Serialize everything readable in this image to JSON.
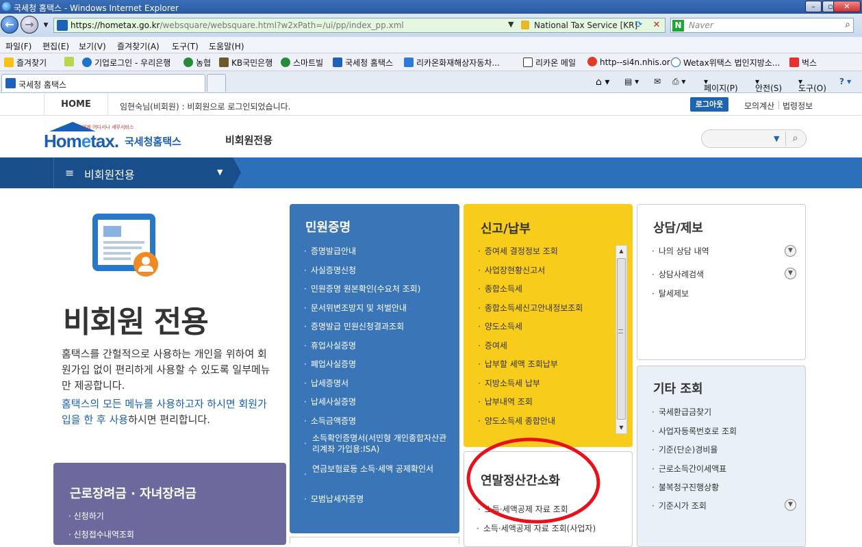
{
  "window": {
    "title": "국세청 홈택스 - Windows Internet Explorer",
    "url_host": "https://hometax.go.kr",
    "url_path": "/websquare/websquare.html?w2xPath=/ui/pp/index_pp.xml",
    "cert_label": "National Tax Service [KR]",
    "search_placeholder": "Naver",
    "search_logo": "N"
  },
  "menubar": [
    "파일(F)",
    "편집(E)",
    "보기(V)",
    "즐겨찾기(A)",
    "도구(T)",
    "도움말(H)"
  ],
  "favorites": {
    "label": "즐겨찾기",
    "items": [
      "기업로그인 - 우리은행",
      "농협",
      "KB국민은행",
      "스마트빌",
      "국세청 홈택스",
      "리카온화재해상자동차...",
      "리카온 메일",
      "http--si4n.nhis.or",
      "Wetax위택스 법인지방소...",
      "벅스"
    ]
  },
  "tabs": {
    "active": "국세청 홈택스"
  },
  "commands": [
    "페이지(P)",
    "안전(S)",
    "도구(O)"
  ],
  "topstrip": {
    "home": "HOME",
    "login_message": "임현숙님(비회원) : 비회원으로 로그인되었습니다.",
    "logout": "로그아웃",
    "mock_calc": "모의계산",
    "law_info": "법령정보"
  },
  "header": {
    "logo_text_a": "Hom",
    "logo_text_b": "e",
    "logo_text_c": "tax.",
    "logo_korean": "국세청홈택스",
    "logo_tag": "언제 어디서나 세무서비스",
    "section_title": "비회원전용"
  },
  "nav": {
    "menu_label": "비회원전용"
  },
  "intro": {
    "title": "비회원 전용",
    "desc1": "홈택스를 간헐적으로 사용하는 개인을 위하여 회원가입 없이 편리하게 사용할 수 있도록 일부메뉴만 제공합니다.",
    "desc2_hl": "홈택스의 모든 메뉴를 사용하고자 하시면 회원가입을 한 후 사용",
    "desc2_rest": "하시면 편리합니다."
  },
  "eitc": {
    "title": "근로장려금 · 자녀장려금",
    "items": [
      "신청하기",
      "신청접수내역조회"
    ]
  },
  "civil": {
    "title": "민원증명",
    "items": [
      "증명발급안내",
      "사실증명신청",
      "민원증명 원본확인(수요처 조회)",
      "문서위변조방지 및 처벌안내",
      "증명발급 민원신청결과조회",
      "휴업사실증명",
      "폐업사실증명",
      "납세증명서",
      "납세사실증명",
      "소득금액증명"
    ],
    "item_isa": "소득확인증명서(서민형 개인종합자산관리계좌 가입용:ISA)",
    "item_pension": "연금보험료등 소득·세액 공제확인서",
    "item_model": "모범납세자증명"
  },
  "report": {
    "title": "신고/납부",
    "items": [
      "증여세 결정정보 조회",
      "사업장현황신고서",
      "종합소득세",
      "종합소득세신고안내정보조회",
      "양도소득세",
      "증여세",
      "납부할 세액 조회납부",
      "지방소득세 납부",
      "납부내역 조회",
      "양도소득세 종합안내"
    ]
  },
  "yearend": {
    "title": "연말정산간소화",
    "items": [
      "소득·세액공제 자료 조회",
      "소득·세액공제 자료 조회(사업자)"
    ]
  },
  "consult": {
    "title": "상담/제보",
    "items": [
      "나의 상담 내역",
      "상담사례검색",
      "탈세제보"
    ]
  },
  "other": {
    "title": "기타 조회",
    "items": [
      "국세환급금찾기",
      "사업자등록번호로 조회",
      "기준(단순)경비율",
      "근로소득간이세액표",
      "불복청구진행상황",
      "기준시가 조회"
    ]
  },
  "colors": {
    "nav_blue": "#2c6fba",
    "civil_blue": "#3a75b8",
    "report_yellow": "#f8cc1a",
    "eitc_purple": "#6c6a9c",
    "annotation_red": "#e8101a"
  }
}
